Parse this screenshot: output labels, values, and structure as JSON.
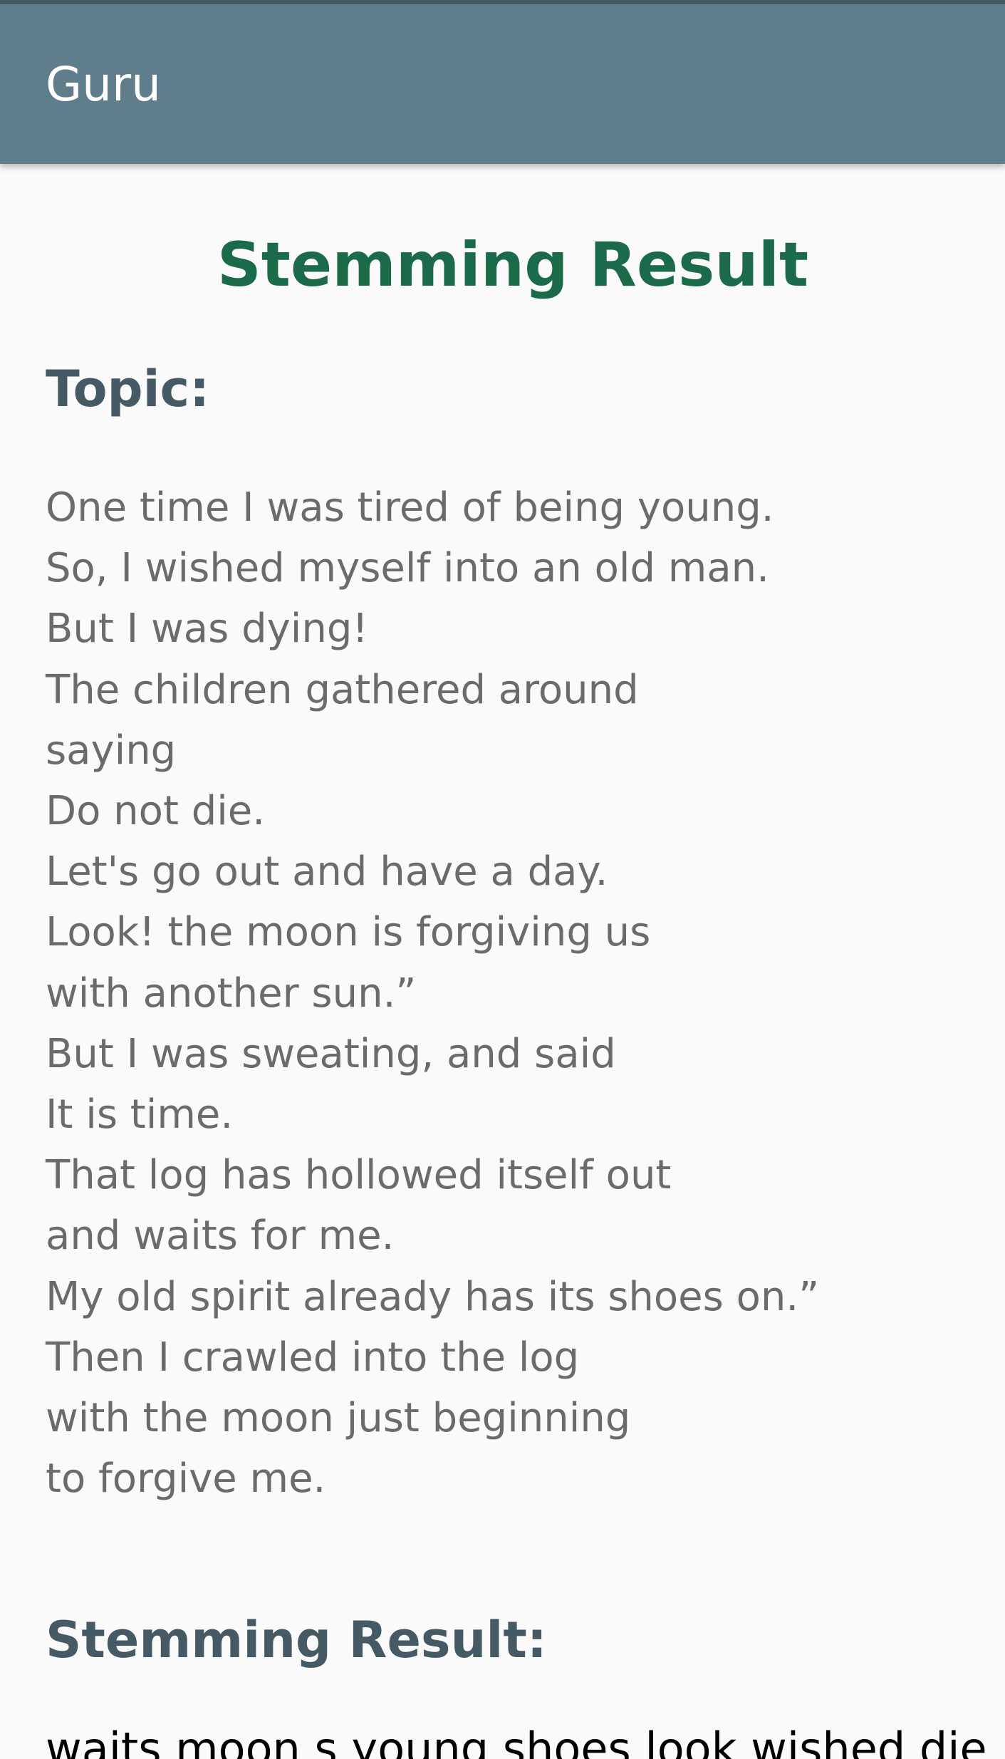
{
  "app_bar": {
    "title": "Guru",
    "color": "#607d8b"
  },
  "page": {
    "title": "Stemming Result",
    "title_color": "#1b6b4a"
  },
  "topic": {
    "label": "Topic:",
    "lines": [
      "One time I was tired of being young.",
      "So, I wished myself into an old man.",
      "But I was dying!",
      "The children gathered around",
      "saying",
      "Do not die.",
      "Let's go out and have a day.",
      "Look! the moon is forgiving us",
      "with another sun.”",
      "But I was sweating, and said",
      "It is time.",
      "That log has hollowed itself out",
      "and waits for me.",
      "My old spirit already has its shoes on.”",
      "Then I crawled into the log",
      "with the moon just beginning",
      "to forgive me."
    ]
  },
  "stemming": {
    "label": "Stemming Result:",
    "text": "waits moon s young shoes look wished die"
  }
}
